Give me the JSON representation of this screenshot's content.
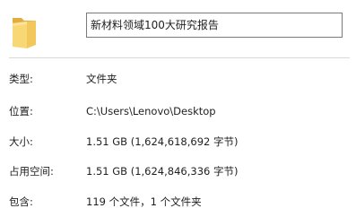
{
  "folder": {
    "icon": "folder-icon",
    "name": "新材料领域100大研究报告"
  },
  "properties": {
    "type": {
      "label": "类型:",
      "value": "文件夹"
    },
    "location": {
      "label": "位置:",
      "value": "C:\\Users\\Lenovo\\Desktop"
    },
    "size": {
      "label": "大小:",
      "value": "1.51 GB (1,624,618,692 字节)"
    },
    "size_on_disk": {
      "label": "占用空间:",
      "value": "1.51 GB (1,624,846,336 字节)"
    },
    "contains": {
      "label": "包含:",
      "value": "119 个文件，1 个文件夹"
    }
  },
  "colors": {
    "folder_front": "#f8d775",
    "folder_back": "#e8b84a",
    "field_border": "#7a7a7a",
    "divider": "#d9d9d9"
  }
}
